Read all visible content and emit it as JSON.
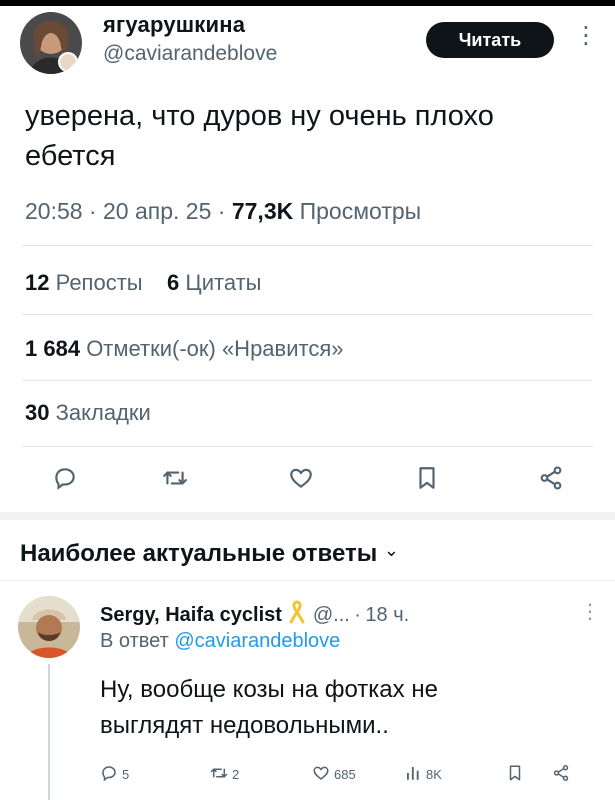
{
  "tweet": {
    "author_name": "ягуарушкина",
    "author_handle": "@caviarandeblove",
    "follow_label": "Читать",
    "text": "уверена, что дуров ну очень плохо ебется",
    "time": "20:58",
    "date": "20 апр. 25",
    "views_count": "77,3K",
    "views_label": "Просмотры",
    "reposts_count": "12",
    "reposts_label": "Репосты",
    "quotes_count": "6",
    "quotes_label": "Цитаты",
    "likes_count": "1 684",
    "likes_label": "Отметки(-ок) «Нравится»",
    "bookmarks_count": "30",
    "bookmarks_label": "Закладки",
    "separator": "·"
  },
  "action_icons": [
    "reply-icon",
    "repost-icon",
    "like-icon",
    "bookmark-icon",
    "share-icon"
  ],
  "replies_section": {
    "title": "Наиболее актуальные ответы",
    "chevron": "⌄"
  },
  "reply": {
    "author_name": "Sergy, Haifa cyclist",
    "author_handle_truncated": "@...",
    "time_ago": "18 ч.",
    "reply_to_prefix": "В ответ",
    "reply_to_handle": "@caviarandeblove",
    "text": "Ну, вообще козы на фотках не выглядят недовольными..",
    "replies": "5",
    "reposts": "2",
    "likes": "685",
    "views": "8K"
  },
  "colors": {
    "text": "#0f1419",
    "secondary": "#536471",
    "link": "#1d9bf0",
    "ribbon": "#f4c430"
  }
}
